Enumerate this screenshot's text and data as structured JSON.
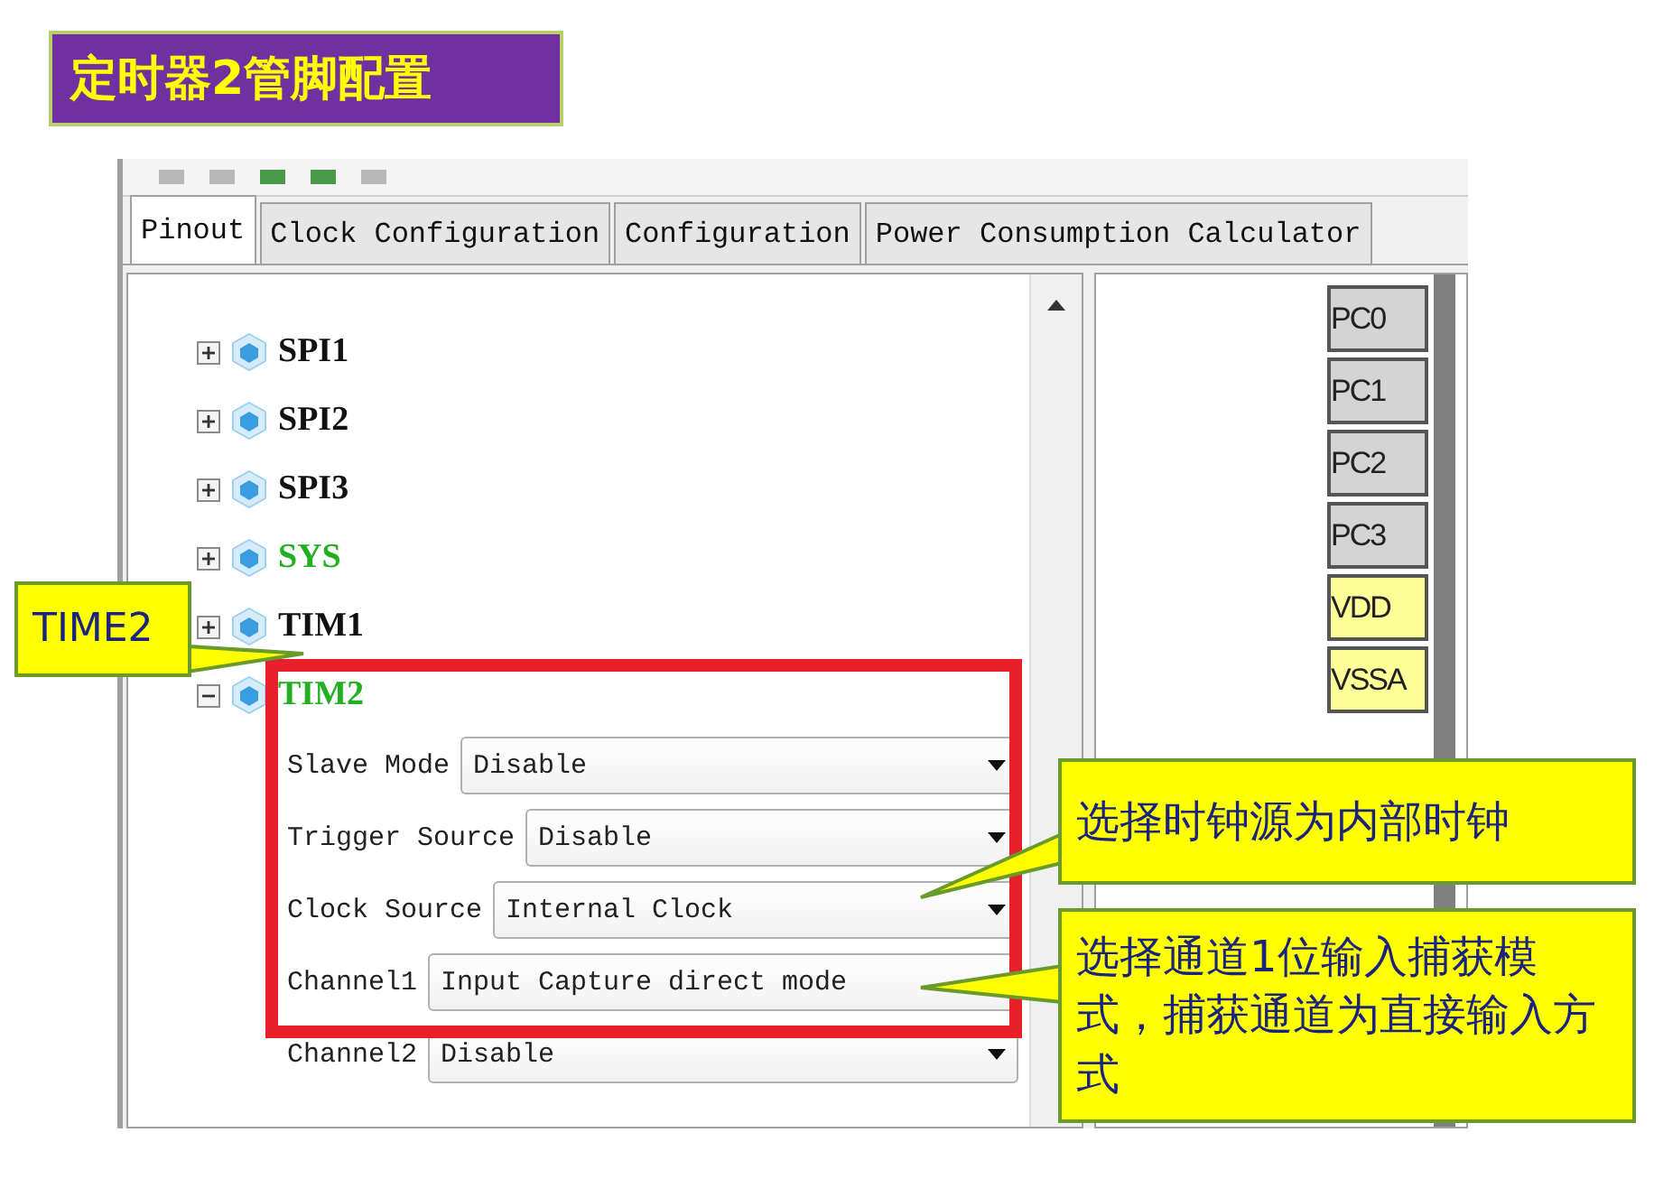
{
  "title": "定时器2管脚配置",
  "tabs": [
    {
      "label": "Pinout",
      "selected": true
    },
    {
      "label": "Clock Configuration",
      "selected": false
    },
    {
      "label": "Configuration",
      "selected": false
    },
    {
      "label": "Power Consumption Calculator",
      "selected": false
    }
  ],
  "tree": [
    {
      "label": "SPI1",
      "configured": false,
      "expanded": false
    },
    {
      "label": "SPI2",
      "configured": false,
      "expanded": false
    },
    {
      "label": "SPI3",
      "configured": false,
      "expanded": false
    },
    {
      "label": "SYS",
      "configured": true,
      "expanded": false
    },
    {
      "label": "TIM1",
      "configured": false,
      "expanded": false
    },
    {
      "label": "TIM2",
      "configured": true,
      "expanded": true,
      "settings": [
        {
          "label": "Slave Mode",
          "value": "Disable",
          "caret_shown": true
        },
        {
          "label": "Trigger Source",
          "value": "Disable",
          "caret_shown": true
        },
        {
          "label": "Clock Source",
          "value": "Internal Clock",
          "caret_shown": true
        },
        {
          "label": "Channel1",
          "value": "Input Capture direct mode",
          "caret_shown": false
        },
        {
          "label": "Channel2",
          "value": "Disable",
          "caret_shown": true
        }
      ]
    }
  ],
  "pins": [
    {
      "label": "PC0",
      "kind": "io"
    },
    {
      "label": "PC1",
      "kind": "io"
    },
    {
      "label": "PC2",
      "kind": "io"
    },
    {
      "label": "PC3",
      "kind": "io"
    },
    {
      "label": "VDD",
      "kind": "power"
    },
    {
      "label": "VSSA",
      "kind": "power"
    }
  ],
  "callouts": [
    {
      "text": "TIME2"
    },
    {
      "text": "选择时钟源为内部时钟"
    },
    {
      "text": "选择通道1位输入捕获模式，捕获通道为直接输入方式"
    }
  ]
}
